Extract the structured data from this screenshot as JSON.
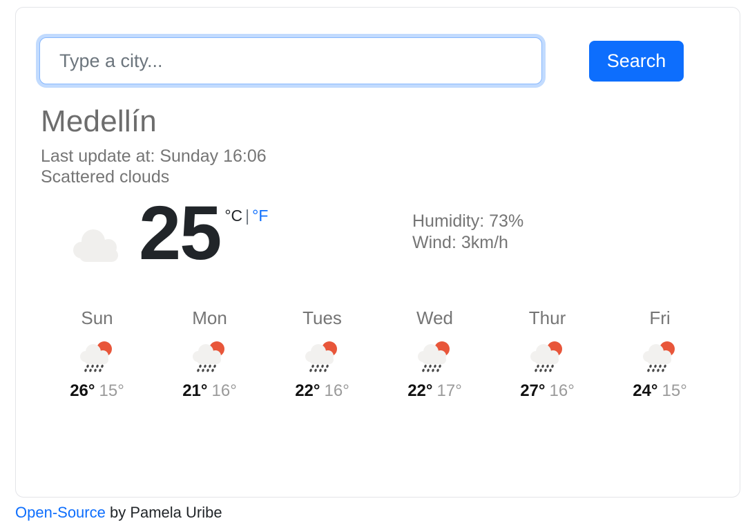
{
  "search": {
    "placeholder": "Type a city...",
    "value": "",
    "button_label": "Search"
  },
  "current": {
    "city": "Medellín",
    "last_update": "Last update at: Sunday 16:06",
    "description": "Scattered clouds",
    "temperature": "25",
    "unit_celsius": "°C",
    "unit_separator": "|",
    "unit_fahrenheit": "°F",
    "humidity": "Humidity: 73%",
    "wind": "Wind: 3km/h",
    "icon": "cloud-icon"
  },
  "forecast": [
    {
      "day": "Sun",
      "max": "26°",
      "min": "15°",
      "icon": "sun-behind-rain-cloud-icon"
    },
    {
      "day": "Mon",
      "max": "21°",
      "min": "16°",
      "icon": "sun-behind-rain-cloud-icon"
    },
    {
      "day": "Tues",
      "max": "22°",
      "min": "16°",
      "icon": "sun-behind-rain-cloud-icon"
    },
    {
      "day": "Wed",
      "max": "22°",
      "min": "17°",
      "icon": "sun-behind-rain-cloud-icon"
    },
    {
      "day": "Thur",
      "max": "27°",
      "min": "16°",
      "icon": "sun-behind-rain-cloud-icon"
    },
    {
      "day": "Fri",
      "max": "24°",
      "min": "15°",
      "icon": "sun-behind-rain-cloud-icon"
    }
  ],
  "footer": {
    "link_label": "Open-Source",
    "credit": " by Pamela Uribe"
  },
  "colors": {
    "accent_blue": "#0d6efd",
    "sun_orange": "#e8563a",
    "cloud_gray": "#f0efed",
    "text_gray": "#757575",
    "temp_black": "#212529"
  }
}
